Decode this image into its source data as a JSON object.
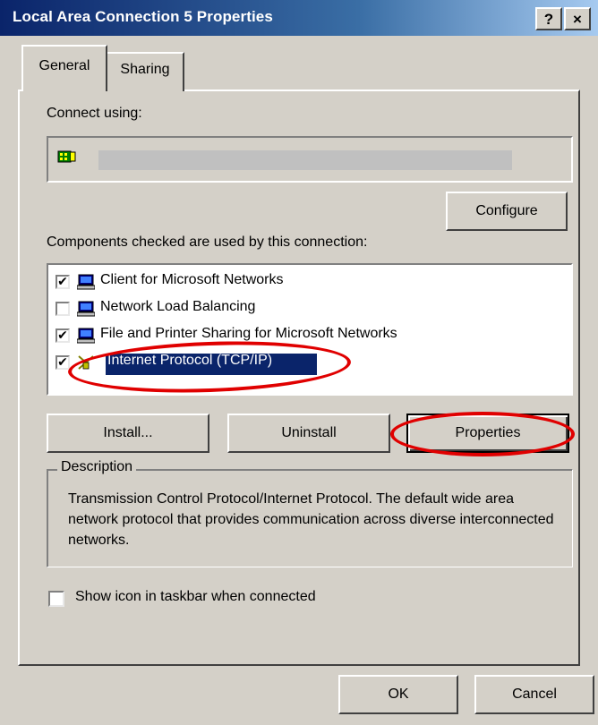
{
  "window": {
    "title": "Local Area Connection 5 Properties",
    "help_label": "?",
    "close_label": "×"
  },
  "tabs": [
    {
      "label": "General",
      "active": true
    },
    {
      "label": "Sharing",
      "active": false
    }
  ],
  "connect_using": {
    "label": "Connect using:",
    "adapter_name": "",
    "configure_label": "Configure"
  },
  "components": {
    "label": "Components checked are used by this connection:",
    "items": [
      {
        "label": "Client for Microsoft Networks",
        "checked": true,
        "icon": "network-client-icon"
      },
      {
        "label": "Network Load Balancing",
        "checked": false,
        "icon": "network-client-icon"
      },
      {
        "label": "File and Printer Sharing for Microsoft Networks",
        "checked": true,
        "icon": "network-client-icon"
      },
      {
        "label": "Internet Protocol (TCP/IP)",
        "checked": true,
        "icon": "protocol-icon",
        "selected": true
      }
    ]
  },
  "buttons": {
    "install": "Install...",
    "uninstall": "Uninstall",
    "properties": "Properties",
    "ok": "OK",
    "cancel": "Cancel"
  },
  "description": {
    "legend": "Description",
    "text": "Transmission Control Protocol/Internet Protocol. The default wide area network protocol that provides communication across diverse interconnected networks."
  },
  "show_icon": {
    "label": "Show icon in taskbar when connected",
    "checked": false
  },
  "colors": {
    "title_bar": "#0a246a",
    "dialog_bg": "#d4d0c8",
    "highlight_oval": "#e00000"
  }
}
